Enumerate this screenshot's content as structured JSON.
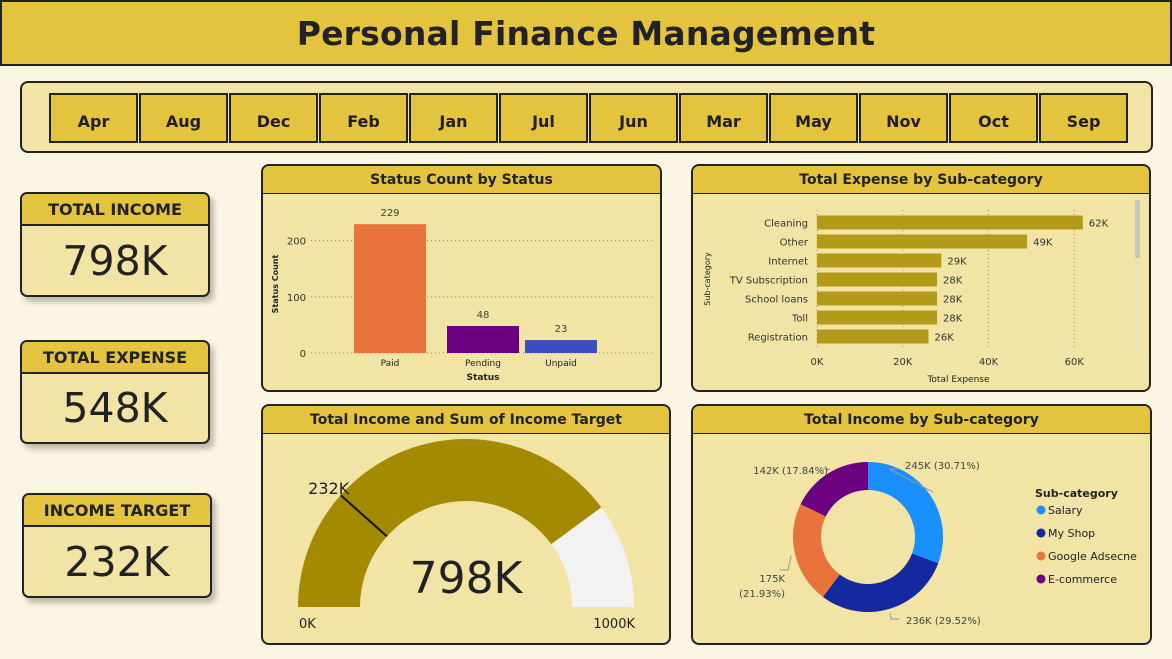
{
  "header": {
    "title": "Personal Finance Management"
  },
  "slicer": {
    "months": [
      "Apr",
      "Aug",
      "Dec",
      "Feb",
      "Jan",
      "Jul",
      "Jun",
      "Mar",
      "May",
      "Nov",
      "Oct",
      "Sep"
    ]
  },
  "kpis": {
    "total_income": {
      "label": "TOTAL INCOME",
      "value": "798K"
    },
    "total_expense": {
      "label": "TOTAL EXPENSE",
      "value": "548K"
    },
    "income_target": {
      "label": "INCOME TARGET",
      "value": "232K"
    }
  },
  "colors": {
    "bar_paid": "#e8733b",
    "bar_pending": "#6b0080",
    "bar_unpaid": "#3c4ec4",
    "expense_bar": "#b39a18",
    "gauge_fill": "#a48a00",
    "gauge_rest": "#f2f2f2",
    "salary": "#1a90ff",
    "my_shop": "#1428a0",
    "google_adsecne": "#e8733b",
    "ecommerce": "#6b0080"
  },
  "chart_data": [
    {
      "type": "bar",
      "title": "Status Count by Status",
      "xlabel": "Status",
      "ylabel": "Status Count",
      "categories": [
        "Paid",
        "Pending",
        "Unpaid"
      ],
      "values": [
        229,
        48,
        23
      ],
      "data_labels": [
        "229",
        "48",
        "23"
      ],
      "yticks": [
        "0",
        "100",
        "200"
      ],
      "ylim": [
        0,
        240
      ],
      "grid": true
    },
    {
      "type": "bar",
      "orientation": "horizontal",
      "title": "Total Expense by Sub-category",
      "xlabel": "Total Expense",
      "ylabel": "Sub-category",
      "categories": [
        "Cleaning",
        "Other",
        "Internet",
        "TV Subscription",
        "School loans",
        "Toll",
        "Registration"
      ],
      "values": [
        62,
        49,
        29,
        28,
        28,
        28,
        26
      ],
      "data_labels": [
        "62K",
        "49K",
        "29K",
        "28K",
        "28K",
        "28K",
        "26K"
      ],
      "xticks": [
        "0K",
        "20K",
        "40K",
        "60K"
      ],
      "xlim": [
        0,
        66
      ],
      "unit": "K",
      "grid": true
    },
    {
      "type": "gauge",
      "title": "Total Income and Sum of Income Target",
      "value": 798,
      "target": 232,
      "min": 0,
      "max": 1000,
      "value_label": "798K",
      "target_label": "232K",
      "min_label": "0K",
      "max_label": "1000K"
    },
    {
      "type": "pie",
      "subtype": "donut",
      "title": "Total Income by Sub-category",
      "legend_title": "Sub-category",
      "legend_position": "right",
      "slices": [
        {
          "name": "Salary",
          "value": 245,
          "label_lines": [
            "245K (30.71%)"
          ]
        },
        {
          "name": "My Shop",
          "value": 236,
          "label_lines": [
            "236K (29.52%)"
          ]
        },
        {
          "name": "Google Adsecne",
          "value": 175,
          "label_lines": [
            "175K",
            "(21.93%)"
          ]
        },
        {
          "name": "E-commerce",
          "value": 142,
          "label_lines": [
            "142K (17.84%)"
          ]
        }
      ]
    }
  ]
}
